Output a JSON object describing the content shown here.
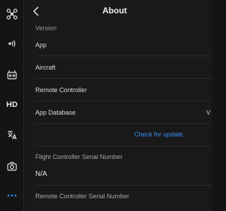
{
  "header": {
    "title": "About"
  },
  "rail": {
    "items": [
      {
        "icon": "drone-icon"
      },
      {
        "icon": "signal-wave-icon"
      },
      {
        "icon": "remote-controller-icon"
      },
      {
        "label": "HD"
      },
      {
        "icon": "translate-icon"
      },
      {
        "icon": "camera-icon"
      },
      {
        "icon": "more-icon"
      }
    ]
  },
  "version": {
    "label": "Version",
    "rows": [
      {
        "label": "App",
        "value": ""
      },
      {
        "label": "Aircraft",
        "value": ""
      },
      {
        "label": "Remote Controller",
        "value": ""
      },
      {
        "label": "App Database",
        "value": "V"
      }
    ],
    "update_link": "Check for update."
  },
  "flight_controller": {
    "label": "Flight Controller Serial Number",
    "value": "N/A"
  },
  "remote_controller": {
    "label": "Remote Controller Serial Number"
  },
  "colors": {
    "accent": "#2b86f0",
    "link": "#3b8ff0"
  }
}
